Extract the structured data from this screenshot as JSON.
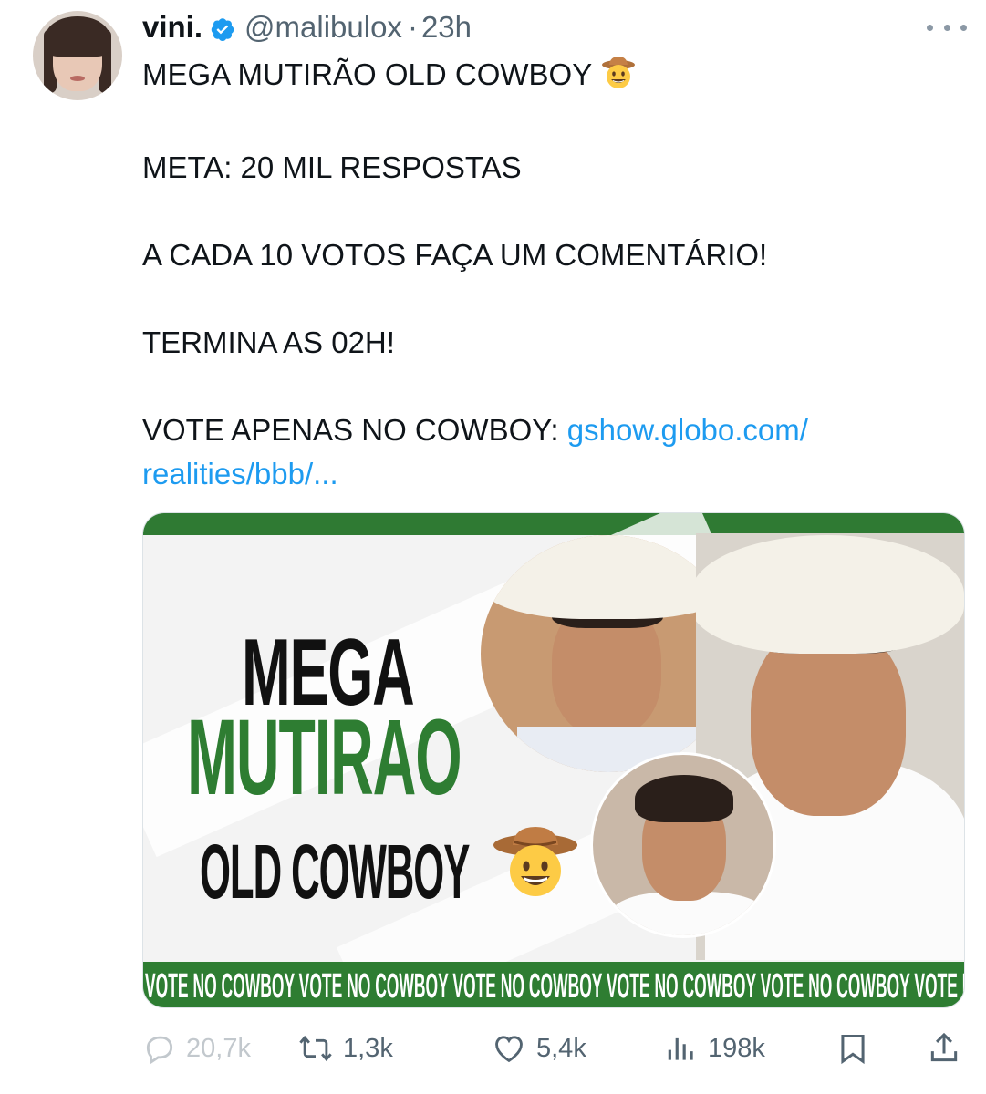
{
  "author": {
    "display_name": "vini.",
    "handle": "@malibulox",
    "separator": "·",
    "time": "23h",
    "verified": true,
    "verified_color": "#1d9bf0"
  },
  "tweet": {
    "line1": "MEGA MUTIRÃO OLD COWBOY",
    "line2": "META: 20 MIL RESPOSTAS",
    "line3": "A CADA 10 VOTOS FAÇA UM COMENTÁRIO!",
    "line4": "TERMINA AS 02H!",
    "line5_text": "VOTE APENAS NO COWBOY: ",
    "link_part1": "gshow.globo.com/",
    "link_part2": "realities/bbb/...",
    "link_color": "#1d9bf0"
  },
  "media": {
    "word_mega": "MEGA",
    "word_mutirao": "MUTIRAO",
    "word_old_cowboy": "OLD COWBOY",
    "banner_text": "VOTE NO COWBOY VOTE NO COWBOY VOTE NO COWBOY  VOTE NO COWBOY VOTE NO COWBOY VOTE NO COWBOY VOTE NO COWBOY VOTE NO COW",
    "accent_color": "#2e7d32"
  },
  "actions": {
    "replies": "20,7k",
    "reposts": "1,3k",
    "likes": "5,4k",
    "views": "198k"
  },
  "icons": {
    "more": "more-horizontal-icon",
    "reply": "reply-icon",
    "repost": "repost-icon",
    "like": "heart-icon",
    "views": "views-chart-icon",
    "bookmark": "bookmark-icon",
    "share": "share-icon"
  }
}
